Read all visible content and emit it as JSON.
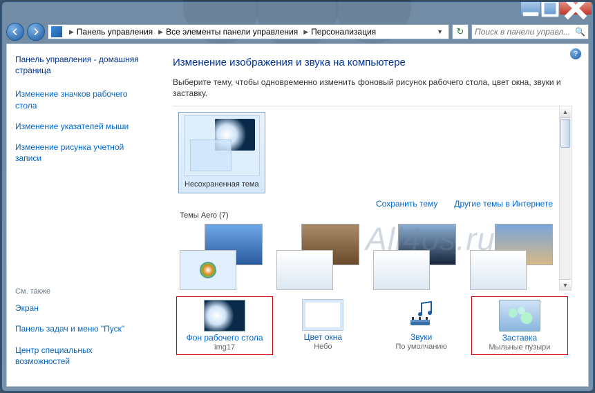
{
  "breadcrumb": {
    "items": [
      "Панель управления",
      "Все элементы панели управления",
      "Персонализация"
    ]
  },
  "search": {
    "placeholder": "Поиск в панели управл..."
  },
  "sidebar": {
    "home": "Панель управления - домашняя страница",
    "links": [
      "Изменение значков рабочего стола",
      "Изменение указателей мыши",
      "Изменение рисунка учетной записи"
    ],
    "see_also_label": "См. также",
    "see_also": [
      "Экран",
      "Панель задач и меню \"Пуск\"",
      "Центр специальных возможностей"
    ]
  },
  "main": {
    "heading": "Изменение изображения и звука на компьютере",
    "desc": "Выберите тему, чтобы одновременно изменить фоновый рисунок рабочего стола, цвет окна, звуки и заставку.",
    "selected_theme_caption": "Несохраненная тема",
    "save_theme": "Сохранить тему",
    "more_themes": "Другие темы в Интернете",
    "aero_label": "Темы Aero (7)"
  },
  "bottom": {
    "items": [
      {
        "title": "Фон рабочего стола",
        "sub": "img17"
      },
      {
        "title": "Цвет окна",
        "sub": "Небо"
      },
      {
        "title": "Звуки",
        "sub": "По умолчанию"
      },
      {
        "title": "Заставка",
        "sub": "Мыльные пузыри"
      }
    ]
  },
  "watermark": "All4os.ru"
}
